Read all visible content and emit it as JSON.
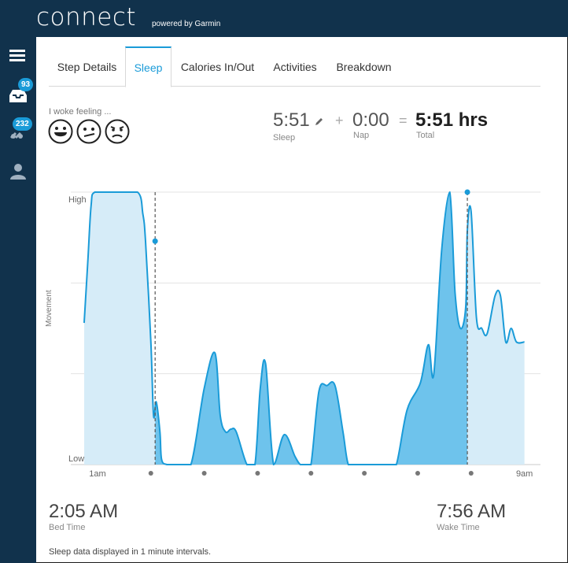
{
  "app": {
    "logo": "connect",
    "powered_by": "powered by Garmin"
  },
  "sidebar": {
    "items": [
      {
        "name": "menu",
        "icon": "hamburger-icon"
      },
      {
        "name": "inbox",
        "icon": "inbox-icon",
        "badge": "93"
      },
      {
        "name": "connections",
        "icon": "connections-icon",
        "badge": "232"
      },
      {
        "name": "profile",
        "icon": "user-icon"
      }
    ]
  },
  "tabs": [
    {
      "label": "Step Details",
      "active": false
    },
    {
      "label": "Sleep",
      "active": true
    },
    {
      "label": "Calories In/Out",
      "active": false
    },
    {
      "label": "Activities",
      "active": false
    },
    {
      "label": "Breakdown",
      "active": false
    }
  ],
  "mood": {
    "label": "I woke feeling ...",
    "faces": [
      "happy-face-icon",
      "neutral-face-icon",
      "unhappy-face-icon"
    ]
  },
  "summary": {
    "sleep": {
      "value": "5:51",
      "label": "Sleep"
    },
    "plus": "+",
    "nap": {
      "value": "0:00",
      "label": "Nap"
    },
    "equals": "=",
    "total": {
      "value": "5:51 hrs",
      "label": "Total"
    }
  },
  "chart_data": {
    "type": "area",
    "ylabel": "Movement",
    "ytick_labels": [
      "High",
      "Low"
    ],
    "xtick_labels": [
      "1am",
      "9am"
    ],
    "x_hours": [
      0.75,
      0.82,
      0.88,
      0.95,
      1.3,
      1.75,
      1.85,
      1.9,
      2.0,
      2.05,
      2.1,
      2.17,
      2.2,
      2.3,
      2.5,
      2.75,
      3.0,
      3.2,
      3.3,
      3.4,
      3.5,
      3.6,
      3.8,
      3.95,
      4.05,
      4.15,
      4.3,
      4.5,
      4.7,
      4.8,
      4.9,
      5.0,
      5.15,
      5.3,
      5.45,
      5.6,
      5.7,
      5.85,
      6.0,
      6.25,
      6.45,
      6.6,
      6.8,
      7.05,
      7.2,
      7.3,
      7.45,
      7.6,
      7.7,
      7.8,
      7.9,
      7.93,
      8.0,
      8.1,
      8.2,
      8.3,
      8.45,
      8.55,
      8.65,
      8.75,
      8.85,
      9.0
    ],
    "movement": [
      0.52,
      0.75,
      0.95,
      1.0,
      1.0,
      1.0,
      0.92,
      0.82,
      0.45,
      0.18,
      0.23,
      0.12,
      0.02,
      0.0,
      0.0,
      0.0,
      0.28,
      0.41,
      0.18,
      0.12,
      0.13,
      0.12,
      0.0,
      0.0,
      0.28,
      0.37,
      0.0,
      0.11,
      0.03,
      0.0,
      0.0,
      0.0,
      0.27,
      0.29,
      0.29,
      0.12,
      0.0,
      0.0,
      0.0,
      0.0,
      0.0,
      0.0,
      0.2,
      0.3,
      0.44,
      0.33,
      0.79,
      1.0,
      0.63,
      0.5,
      0.58,
      0.86,
      0.93,
      0.54,
      0.5,
      0.48,
      0.62,
      0.62,
      0.45,
      0.5,
      0.45,
      0.45
    ],
    "bed_time_hours": 2.08,
    "wake_time_hours": 7.93,
    "x_range": [
      0.5,
      9.3
    ],
    "y_range": [
      0,
      1
    ],
    "grid": true,
    "colors": {
      "line": "#1a9bd8",
      "awake_fill": "#d6ecf8",
      "sleep_fill": "#6ec3ec",
      "grid": "#e3e3e3",
      "axis": "#c8c8c8"
    }
  },
  "bed_time": {
    "value": "2:05 AM",
    "label": "Bed Time"
  },
  "wake_time": {
    "value": "7:56 AM",
    "label": "Wake Time"
  },
  "footnote": "Sleep data displayed in 1 minute intervals."
}
